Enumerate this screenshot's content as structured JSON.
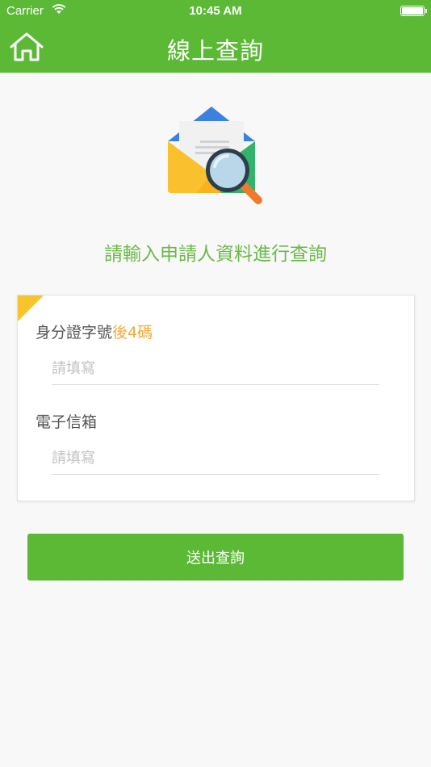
{
  "status_bar": {
    "carrier": "Carrier",
    "time": "10:45 AM"
  },
  "nav": {
    "title": "線上查詢",
    "home_icon": "home-icon"
  },
  "prompt": "請輸入申請人資料進行查詢",
  "form": {
    "id_label": "身分證字號",
    "id_label_accent": "後4碼",
    "id_placeholder": "請填寫",
    "email_label": "電子信箱",
    "email_placeholder": "請填寫"
  },
  "submit_label": "送出查詢",
  "colors": {
    "primary": "#5bb935",
    "accent": "#f3a93b",
    "corner": "#f9c32c"
  }
}
